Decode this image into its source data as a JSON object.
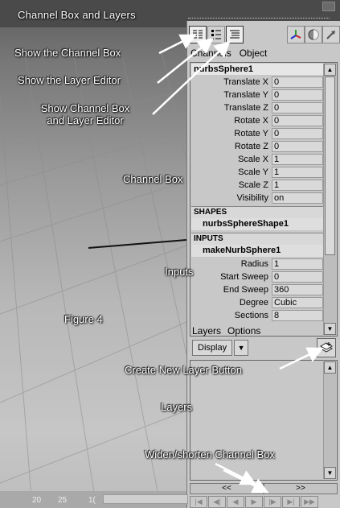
{
  "window_title": "Channel Box and Layers",
  "tabs": {
    "channels": "Channels",
    "object": "Object"
  },
  "object_name": "nurbsSphere1",
  "transform_attributes": [
    {
      "label": "Translate X",
      "value": "0"
    },
    {
      "label": "Translate Y",
      "value": "0"
    },
    {
      "label": "Translate Z",
      "value": "0"
    },
    {
      "label": "Rotate X",
      "value": "0"
    },
    {
      "label": "Rotate Y",
      "value": "0"
    },
    {
      "label": "Rotate Z",
      "value": "0"
    },
    {
      "label": "Scale X",
      "value": "1"
    },
    {
      "label": "Scale Y",
      "value": "1"
    },
    {
      "label": "Scale Z",
      "value": "1"
    },
    {
      "label": "Visibility",
      "value": "on"
    }
  ],
  "shapes": {
    "header": "SHAPES",
    "name": "nurbsSphereShape1"
  },
  "inputs": {
    "header": "INPUTS",
    "name": "makeNurbSphere1",
    "attributes": [
      {
        "label": "Radius",
        "value": "1"
      },
      {
        "label": "Start Sweep",
        "value": "0"
      },
      {
        "label": "End Sweep",
        "value": "360"
      },
      {
        "label": "Degree",
        "value": "Cubic"
      },
      {
        "label": "Sections",
        "value": "8"
      }
    ]
  },
  "layers_menu": {
    "layers": "Layers",
    "options": "Options"
  },
  "display_dropdown": "Display",
  "widen_buttons": {
    "left": "<<",
    "right": ">>"
  },
  "timeline_ticks": [
    "20",
    "25",
    "1("
  ],
  "annotations": {
    "show_channel_box": "Show the Channel Box",
    "show_layer_editor": "Show the Layer Editor",
    "show_both_line1": "Show Channel Box",
    "show_both_line2": "and Layer Editor",
    "channel_box": "Channel Box",
    "inputs": "Inputs",
    "figure": "Figure 4",
    "create_new_layer": "Create New Layer Button",
    "layers": "Layers",
    "widen": "Widen/shorten Channel Box"
  }
}
